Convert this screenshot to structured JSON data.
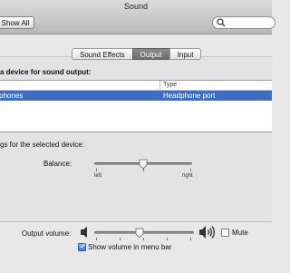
{
  "window": {
    "title": "Sound"
  },
  "toolbar": {
    "show_all_label": "Show All",
    "search": {
      "value": "",
      "icon": "search-icon"
    }
  },
  "tabs": [
    {
      "label": "Sound Effects",
      "active": false
    },
    {
      "label": "Output",
      "active": true
    },
    {
      "label": "Input",
      "active": false
    }
  ],
  "device_section": {
    "heading": "a device for sound output:",
    "columns": {
      "name": "",
      "type": "Type"
    },
    "rows": [
      {
        "name": "phones",
        "type": "Headphone port",
        "selected": true
      }
    ]
  },
  "settings": {
    "label": "gs for the selected device:",
    "balance": {
      "label": "Balance:",
      "left_label": "left",
      "right_label": "right",
      "value": 0.5
    }
  },
  "output": {
    "label": "Output volume:",
    "volume": 0.45,
    "mute_label": "Mute",
    "mute_checked": false,
    "show_in_menu_bar_label": "Show volume in menu bar",
    "show_in_menu_bar_checked": true
  },
  "colors": {
    "selection": "#3b6dc7",
    "active_tab": "#6d6d6d"
  }
}
